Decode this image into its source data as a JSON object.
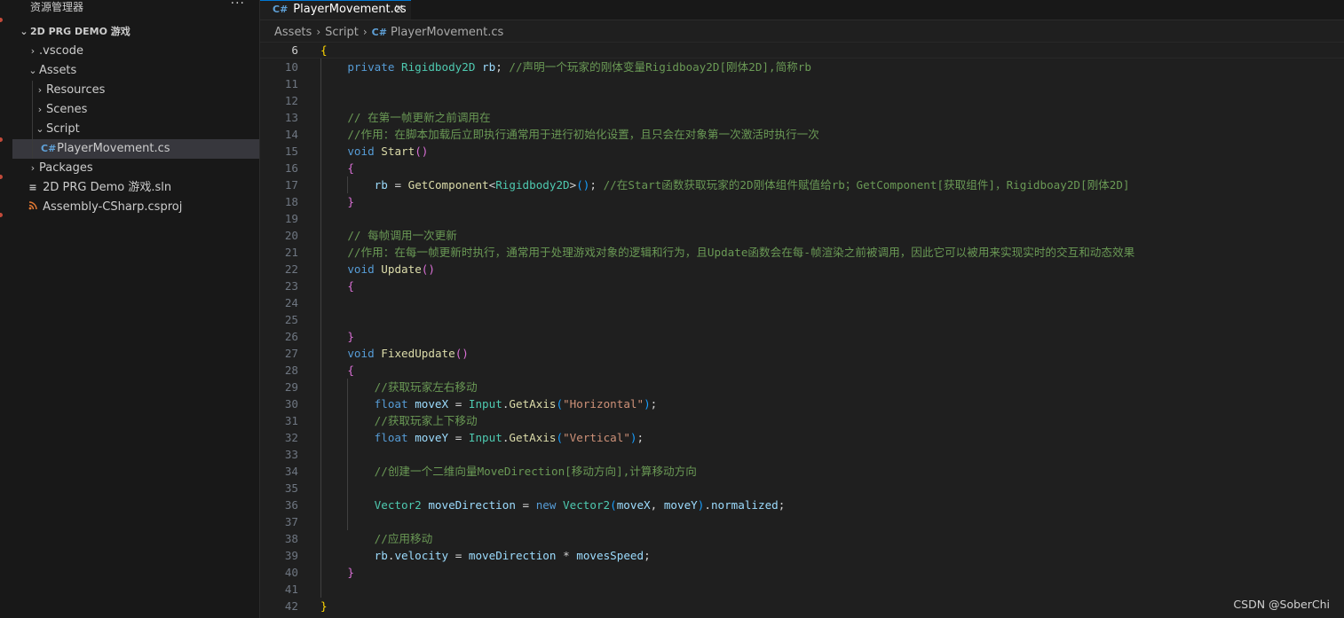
{
  "sidebar": {
    "title": "资源管理器",
    "more_label": "···",
    "project": "2D PRG DEMO 游戏",
    "items": [
      {
        "label": ".vscode",
        "kind": "folder",
        "expanded": false
      },
      {
        "label": "Assets",
        "kind": "folder",
        "expanded": true
      },
      {
        "label": "Resources",
        "kind": "folder",
        "expanded": false
      },
      {
        "label": "Scenes",
        "kind": "folder",
        "expanded": false
      },
      {
        "label": "Script",
        "kind": "folder",
        "expanded": true
      },
      {
        "label": "PlayerMovement.cs",
        "kind": "csharp-file",
        "selected": true
      },
      {
        "label": "Packages",
        "kind": "folder",
        "expanded": false
      },
      {
        "label": "2D PRG Demo 游戏.sln",
        "kind": "solution-file"
      },
      {
        "label": "Assembly-CSharp.csproj",
        "kind": "project-file"
      }
    ]
  },
  "tab": {
    "label": "PlayerMovement.cs",
    "close": "✕"
  },
  "breadcrumb": {
    "items": [
      "Assets",
      "Script",
      "PlayerMovement.cs"
    ]
  },
  "editor": {
    "lines": [
      {
        "n": "6",
        "active": true,
        "tokens": [
          [
            "b1",
            "{"
          ]
        ]
      },
      {
        "n": "10",
        "tokens": [
          [
            "ws",
            "    "
          ],
          [
            "kw",
            "private"
          ],
          [
            "ws",
            " "
          ],
          [
            "type",
            "Rigidbody2D"
          ],
          [
            "ws",
            " "
          ],
          [
            "var",
            "rb"
          ],
          [
            "pun",
            ";"
          ],
          [
            "ws",
            " "
          ],
          [
            "cm",
            "//声明一个玩家的刚体变量Rigidboay2D[刚体2D],简称rb"
          ]
        ]
      },
      {
        "n": "11",
        "tokens": []
      },
      {
        "n": "12",
        "tokens": []
      },
      {
        "n": "13",
        "tokens": [
          [
            "ws",
            "    "
          ],
          [
            "cm",
            "// 在第一帧更新之前调用在"
          ]
        ]
      },
      {
        "n": "14",
        "tokens": [
          [
            "ws",
            "    "
          ],
          [
            "cm",
            "//作用：在脚本加载后立即执行通常用于进行初始化设置，且只会在对象第一次激活时执行一次"
          ]
        ]
      },
      {
        "n": "15",
        "tokens": [
          [
            "ws",
            "    "
          ],
          [
            "kw",
            "void"
          ],
          [
            "ws",
            " "
          ],
          [
            "fn",
            "Start"
          ],
          [
            "b2",
            "()"
          ]
        ]
      },
      {
        "n": "16",
        "tokens": [
          [
            "ws",
            "    "
          ],
          [
            "b2",
            "{"
          ]
        ]
      },
      {
        "n": "17",
        "tokens": [
          [
            "ws",
            "        "
          ],
          [
            "var",
            "rb"
          ],
          [
            "ws",
            " "
          ],
          [
            "pun",
            "="
          ],
          [
            "ws",
            " "
          ],
          [
            "fn",
            "GetComponent"
          ],
          [
            "pun",
            "<"
          ],
          [
            "type",
            "Rigidbody2D"
          ],
          [
            "pun",
            ">"
          ],
          [
            "b3",
            "()"
          ],
          [
            "pun",
            ";"
          ],
          [
            "ws",
            " "
          ],
          [
            "cm",
            "//在Start函数获取玩家的2D刚体组件赋值给rb；GetComponent[获取组件]，Rigidboay2D[刚体2D]"
          ]
        ]
      },
      {
        "n": "18",
        "tokens": [
          [
            "ws",
            "    "
          ],
          [
            "b2",
            "}"
          ]
        ]
      },
      {
        "n": "19",
        "tokens": []
      },
      {
        "n": "20",
        "tokens": [
          [
            "ws",
            "    "
          ],
          [
            "cm",
            "// 每帧调用一次更新"
          ]
        ]
      },
      {
        "n": "21",
        "tokens": [
          [
            "ws",
            "    "
          ],
          [
            "cm",
            "//作用：在每一帧更新时执行，通常用于处理游戏对象的逻辑和行为，且Update函数会在每-帧渲染之前被调用，因此它可以被用来实现实时的交互和动态效果"
          ]
        ]
      },
      {
        "n": "22",
        "tokens": [
          [
            "ws",
            "    "
          ],
          [
            "kw",
            "void"
          ],
          [
            "ws",
            " "
          ],
          [
            "fn",
            "Update"
          ],
          [
            "b2",
            "()"
          ]
        ]
      },
      {
        "n": "23",
        "tokens": [
          [
            "ws",
            "    "
          ],
          [
            "b2",
            "{"
          ]
        ]
      },
      {
        "n": "24",
        "tokens": []
      },
      {
        "n": "25",
        "tokens": []
      },
      {
        "n": "26",
        "tokens": [
          [
            "ws",
            "    "
          ],
          [
            "b2",
            "}"
          ]
        ]
      },
      {
        "n": "27",
        "tokens": [
          [
            "ws",
            "    "
          ],
          [
            "kw",
            "void"
          ],
          [
            "ws",
            " "
          ],
          [
            "fn",
            "FixedUpdate"
          ],
          [
            "b2",
            "()"
          ]
        ]
      },
      {
        "n": "28",
        "tokens": [
          [
            "ws",
            "    "
          ],
          [
            "b2",
            "{"
          ]
        ]
      },
      {
        "n": "29",
        "tokens": [
          [
            "ws",
            "        "
          ],
          [
            "cm",
            "//获取玩家左右移动"
          ]
        ]
      },
      {
        "n": "30",
        "tokens": [
          [
            "ws",
            "        "
          ],
          [
            "kw",
            "float"
          ],
          [
            "ws",
            " "
          ],
          [
            "var",
            "moveX"
          ],
          [
            "ws",
            " "
          ],
          [
            "pun",
            "="
          ],
          [
            "ws",
            " "
          ],
          [
            "type",
            "Input"
          ],
          [
            "pun",
            "."
          ],
          [
            "fn",
            "GetAxis"
          ],
          [
            "b3",
            "("
          ],
          [
            "str",
            "\"Horizontal\""
          ],
          [
            "b3",
            ")"
          ],
          [
            "pun",
            ";"
          ]
        ]
      },
      {
        "n": "31",
        "tokens": [
          [
            "ws",
            "        "
          ],
          [
            "cm",
            "//获取玩家上下移动"
          ]
        ]
      },
      {
        "n": "32",
        "tokens": [
          [
            "ws",
            "        "
          ],
          [
            "kw",
            "float"
          ],
          [
            "ws",
            " "
          ],
          [
            "var",
            "moveY"
          ],
          [
            "ws",
            " "
          ],
          [
            "pun",
            "="
          ],
          [
            "ws",
            " "
          ],
          [
            "type",
            "Input"
          ],
          [
            "pun",
            "."
          ],
          [
            "fn",
            "GetAxis"
          ],
          [
            "b3",
            "("
          ],
          [
            "str",
            "\"Vertical\""
          ],
          [
            "b3",
            ")"
          ],
          [
            "pun",
            ";"
          ]
        ]
      },
      {
        "n": "33",
        "tokens": []
      },
      {
        "n": "34",
        "tokens": [
          [
            "ws",
            "        "
          ],
          [
            "cm",
            "//创建一个二维向量MoveDirection[移动方向],计算移动方向"
          ]
        ]
      },
      {
        "n": "35",
        "tokens": []
      },
      {
        "n": "36",
        "tokens": [
          [
            "ws",
            "        "
          ],
          [
            "type",
            "Vector2"
          ],
          [
            "ws",
            " "
          ],
          [
            "var",
            "moveDirection"
          ],
          [
            "ws",
            " "
          ],
          [
            "pun",
            "="
          ],
          [
            "ws",
            " "
          ],
          [
            "kw",
            "new"
          ],
          [
            "ws",
            " "
          ],
          [
            "type",
            "Vector2"
          ],
          [
            "b3",
            "("
          ],
          [
            "var",
            "moveX"
          ],
          [
            "pun",
            ","
          ],
          [
            "ws",
            " "
          ],
          [
            "var",
            "moveY"
          ],
          [
            "b3",
            ")"
          ],
          [
            "pun",
            "."
          ],
          [
            "var",
            "normalized"
          ],
          [
            "pun",
            ";"
          ]
        ]
      },
      {
        "n": "37",
        "tokens": []
      },
      {
        "n": "38",
        "tokens": [
          [
            "ws",
            "        "
          ],
          [
            "cm",
            "//应用移动"
          ]
        ]
      },
      {
        "n": "39",
        "tokens": [
          [
            "ws",
            "        "
          ],
          [
            "var",
            "rb"
          ],
          [
            "pun",
            "."
          ],
          [
            "var",
            "velocity"
          ],
          [
            "ws",
            " "
          ],
          [
            "pun",
            "="
          ],
          [
            "ws",
            " "
          ],
          [
            "var",
            "moveDirection"
          ],
          [
            "ws",
            " "
          ],
          [
            "pun",
            "*"
          ],
          [
            "ws",
            " "
          ],
          [
            "var",
            "movesSpeed"
          ],
          [
            "pun",
            ";"
          ]
        ]
      },
      {
        "n": "40",
        "tokens": [
          [
            "ws",
            "    "
          ],
          [
            "b2",
            "}"
          ]
        ]
      },
      {
        "n": "41",
        "tokens": []
      },
      {
        "n": "42",
        "tokens": [
          [
            "b1",
            "}"
          ]
        ]
      }
    ]
  },
  "watermark": "CSDN @SoberChi",
  "colors": {
    "background": "#1f1f1f",
    "sidebar": "#181818",
    "keyword": "#569cd6",
    "type": "#4ec9b0",
    "variable": "#9cdcfe",
    "function": "#dcdcaa",
    "comment": "#6a9955",
    "string": "#ce9178",
    "accent": "#0078d4"
  },
  "icons": {
    "csharp": "C#",
    "solution": "≡",
    "rss": "rss-icon"
  }
}
